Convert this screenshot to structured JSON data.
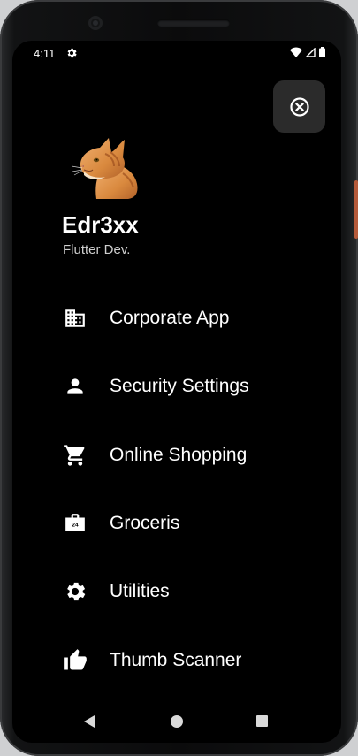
{
  "status_bar": {
    "time": "4:11",
    "icons": [
      "settings-icon",
      "wifi-icon",
      "signal-icon",
      "battery-icon"
    ]
  },
  "drawer": {
    "close_icon": "close-circle-icon",
    "profile": {
      "avatar": "cat-avatar",
      "name": "Edr3xx",
      "role": "Flutter Dev."
    },
    "items": [
      {
        "label": "Corporate App",
        "icon": "business-icon"
      },
      {
        "label": "Security Settings",
        "icon": "person-icon"
      },
      {
        "label": "Online Shopping",
        "icon": "shopping-cart-icon"
      },
      {
        "label": "Groceris",
        "icon": "store-24h-icon"
      },
      {
        "label": "Utilities",
        "icon": "settings-icon"
      },
      {
        "label": "Thumb Scanner",
        "icon": "thumb-up-icon"
      }
    ]
  },
  "nav_bar": {
    "buttons": [
      "back-icon",
      "home-icon",
      "recents-icon"
    ]
  },
  "colors": {
    "background": "#000000",
    "text": "#ffffff",
    "close_button_bg": "#2b2b2b"
  }
}
